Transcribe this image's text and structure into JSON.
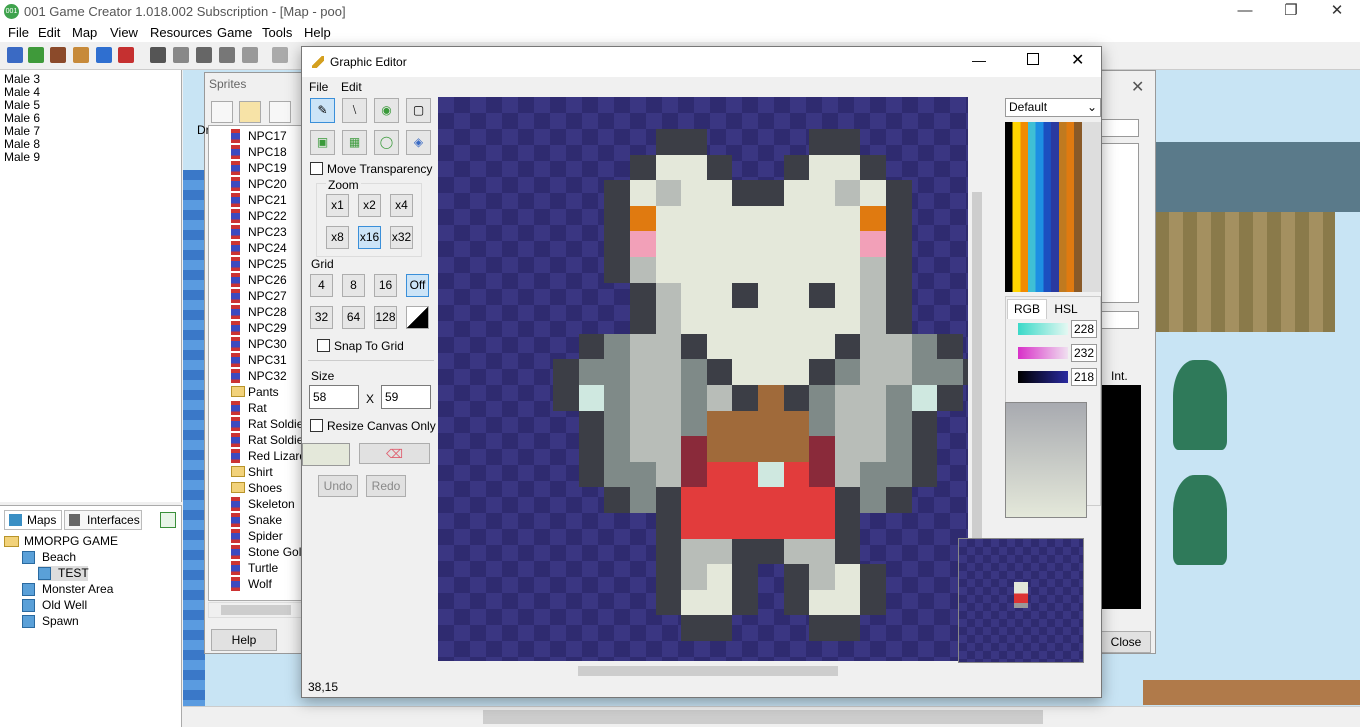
{
  "app": {
    "title": "001 Game Creator 1.018.002 Subscription - [Map - poo]",
    "icon_text": "001",
    "menu": [
      "File",
      "Edit",
      "Map",
      "View",
      "Resources",
      "Game",
      "Tools",
      "Help"
    ]
  },
  "left_list": [
    "Male 3",
    "Male 4",
    "Male 5",
    "Male 6",
    "Male 7",
    "Male 8",
    "Male 9"
  ],
  "tree_panel": {
    "tabs": [
      "Maps",
      "Interfaces"
    ],
    "items": [
      {
        "label": "MMORPG GAME",
        "level": 0
      },
      {
        "label": "Beach",
        "level": 1
      },
      {
        "label": "TEST",
        "level": 2
      },
      {
        "label": "Monster Area",
        "level": 1
      },
      {
        "label": "Old Well",
        "level": 1
      },
      {
        "label": "Spawn",
        "level": 1
      }
    ]
  },
  "sprites_window": {
    "title": "Sprites",
    "row_prefix": "Dr",
    "items": [
      {
        "label": "NPC17",
        "type": "sprite"
      },
      {
        "label": "NPC18",
        "type": "sprite"
      },
      {
        "label": "NPC19",
        "type": "sprite"
      },
      {
        "label": "NPC20",
        "type": "sprite"
      },
      {
        "label": "NPC21",
        "type": "sprite"
      },
      {
        "label": "NPC22",
        "type": "sprite"
      },
      {
        "label": "NPC23",
        "type": "sprite"
      },
      {
        "label": "NPC24",
        "type": "sprite"
      },
      {
        "label": "NPC25",
        "type": "sprite"
      },
      {
        "label": "NPC26",
        "type": "sprite"
      },
      {
        "label": "NPC27",
        "type": "sprite"
      },
      {
        "label": "NPC28",
        "type": "sprite"
      },
      {
        "label": "NPC29",
        "type": "sprite"
      },
      {
        "label": "NPC30",
        "type": "sprite"
      },
      {
        "label": "NPC31",
        "type": "sprite"
      },
      {
        "label": "NPC32",
        "type": "sprite"
      },
      {
        "label": "Pants",
        "type": "folder"
      },
      {
        "label": "Rat",
        "type": "sprite"
      },
      {
        "label": "Rat Soldier",
        "type": "sprite"
      },
      {
        "label": "Rat Soldier",
        "type": "sprite"
      },
      {
        "label": "Red Lizard",
        "type": "sprite"
      },
      {
        "label": "Shirt",
        "type": "folder"
      },
      {
        "label": "Shoes",
        "type": "folder"
      },
      {
        "label": "Skeleton",
        "type": "sprite"
      },
      {
        "label": "Snake",
        "type": "sprite"
      },
      {
        "label": "Spider",
        "type": "sprite"
      },
      {
        "label": "Stone Gole",
        "type": "sprite"
      },
      {
        "label": "Turtle",
        "type": "sprite"
      },
      {
        "label": "Wolf",
        "type": "sprite"
      }
    ],
    "help_label": "Help"
  },
  "graphic_editor": {
    "title": "Graphic Editor",
    "menu": [
      "File",
      "Edit"
    ],
    "move_transparency_label": "Move Transparency",
    "zoom_label": "Zoom",
    "zoom_options": [
      "x1",
      "x2",
      "x4",
      "x8",
      "x16",
      "x32"
    ],
    "zoom_selected": "x16",
    "grid_label": "Grid",
    "grid_options": [
      "4",
      "8",
      "16",
      "Off",
      "32",
      "64",
      "128"
    ],
    "grid_selected": "Off",
    "snap_to_grid_label": "Snap To Grid",
    "size_label": "Size",
    "width": "58",
    "height": "59",
    "size_separator": "X",
    "resize_canvas_only_label": "Resize Canvas Only",
    "undo_label": "Undo",
    "redo_label": "Redo",
    "palette_dropdown": "Default",
    "color_tabs": [
      "RGB",
      "HSL"
    ],
    "rgb_values": [
      "228",
      "232",
      "218"
    ],
    "cursor_position": "38,15",
    "primary_color": "#e4e8da",
    "canvas_bg": "#3a3682"
  },
  "right_dialog": {
    "int_label": "Int.",
    "close_label": "Close"
  }
}
